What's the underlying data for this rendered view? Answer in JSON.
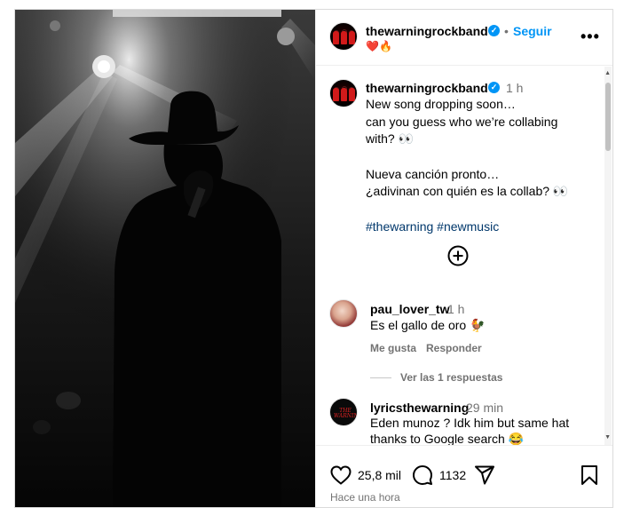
{
  "post": {
    "author": "thewarningrockband",
    "follow_label": "Seguir",
    "header_emojis": "❤️🔥",
    "more_label": "•••",
    "caption_time": "1 h",
    "caption_lines": [
      "New song dropping soon…",
      "can you guess who we’re collabing",
      "with? 👀",
      "Nueva canción pronto…",
      "¿adivinan con quién es la collab? 👀"
    ],
    "hashtags": [
      "#thewarning",
      "#newmusic"
    ]
  },
  "comments": [
    {
      "user": "pau_lover_tw",
      "time": "1 h",
      "text": "Es el gallo de oro 🐓",
      "like_label": "Me gusta",
      "reply_label": "Responder",
      "view_replies_label": "Ver las 1 respuestas"
    },
    {
      "user": "lyricsthewarning",
      "time": "29 min",
      "avatar_text": "THE WARNING",
      "text_lines": [
        "Eden munoz ? Idk him but same hat",
        "thanks to Google search 😂"
      ]
    }
  ],
  "actions": {
    "likes": "25,8 mil",
    "comments": "1132",
    "posted_ago": "Hace una hora"
  },
  "icons": {
    "like": "heart-icon",
    "comment": "comment-bubble-icon",
    "share": "paper-plane-icon",
    "save": "bookmark-icon",
    "add": "plus-circle-icon",
    "more": "more-options-icon",
    "verified": "verified-badge-icon"
  },
  "colors": {
    "accent": "#0095f6",
    "hashtag": "#00376b",
    "muted": "#737373",
    "border": "#dbdbdb"
  }
}
